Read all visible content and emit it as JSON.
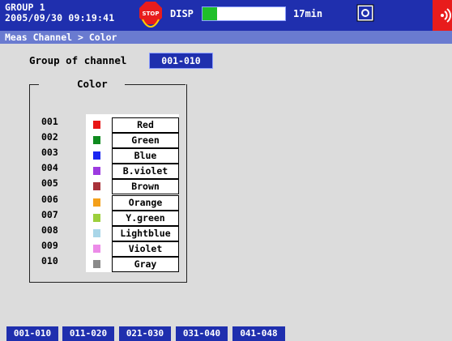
{
  "header": {
    "group": "GROUP 1",
    "datetime": "2005/09/30 09:19:41",
    "stop_icon_text": "STOP",
    "disp": "DISP",
    "memory_fill_fraction": 0.18,
    "memory_time": "17min",
    "icons": [
      "stop-icon",
      "camera-icon",
      "alarm-icon"
    ]
  },
  "breadcrumb": "Meas Channel > Color",
  "group_of_channel": {
    "label": "Group of channel",
    "value": "001-010"
  },
  "color_section": {
    "title": "Color",
    "rows": [
      {
        "ch": "001",
        "name": "Red",
        "color": "#e81515"
      },
      {
        "ch": "002",
        "name": "Green",
        "color": "#0f8a1f"
      },
      {
        "ch": "003",
        "name": "Blue",
        "color": "#1a26f2"
      },
      {
        "ch": "004",
        "name": "B.violet",
        "color": "#9c3ae0"
      },
      {
        "ch": "005",
        "name": "Brown",
        "color": "#a8323a"
      },
      {
        "ch": "006",
        "name": "Orange",
        "color": "#f4a01a"
      },
      {
        "ch": "007",
        "name": "Y.green",
        "color": "#9ccf3c"
      },
      {
        "ch": "008",
        "name": "Lightblue",
        "color": "#a9d6e8"
      },
      {
        "ch": "009",
        "name": "Violet",
        "color": "#ec8be8"
      },
      {
        "ch": "010",
        "name": "Gray",
        "color": "#8a8a8a"
      }
    ]
  },
  "tabs": [
    "001-010",
    "011-020",
    "021-030",
    "031-040",
    "041-048"
  ],
  "colors": {
    "header_bg": "#1f2fae",
    "breadcrumb_bg": "#6a7bd0",
    "page_bg": "#dcdcdc",
    "memory_fill": "#1fbf2a"
  }
}
